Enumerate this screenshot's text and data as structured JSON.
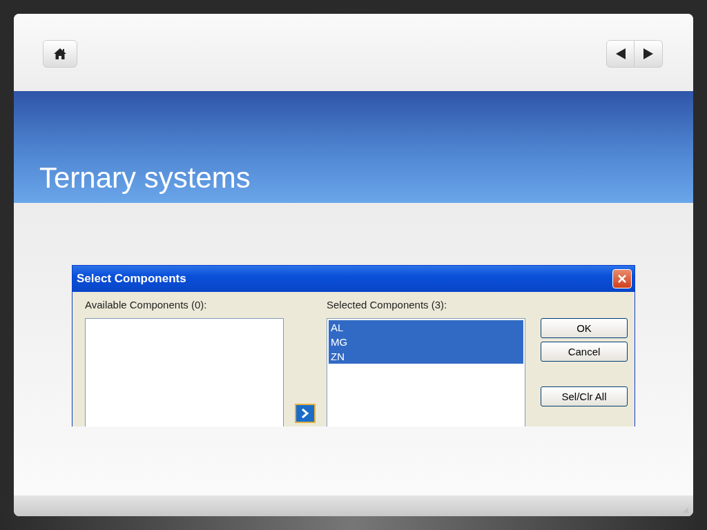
{
  "slide": {
    "title": "Ternary systems"
  },
  "dialog": {
    "title": "Select Components",
    "available": {
      "label": "Available Components (0):"
    },
    "selected_list": {
      "label": "Selected Components (3):",
      "items": [
        {
          "label": "AL",
          "selected": true
        },
        {
          "label": "MG",
          "selected": true
        },
        {
          "label": "ZN",
          "selected": true
        }
      ]
    },
    "buttons": [
      "OK",
      "Cancel",
      "Sel/Clr All"
    ]
  }
}
